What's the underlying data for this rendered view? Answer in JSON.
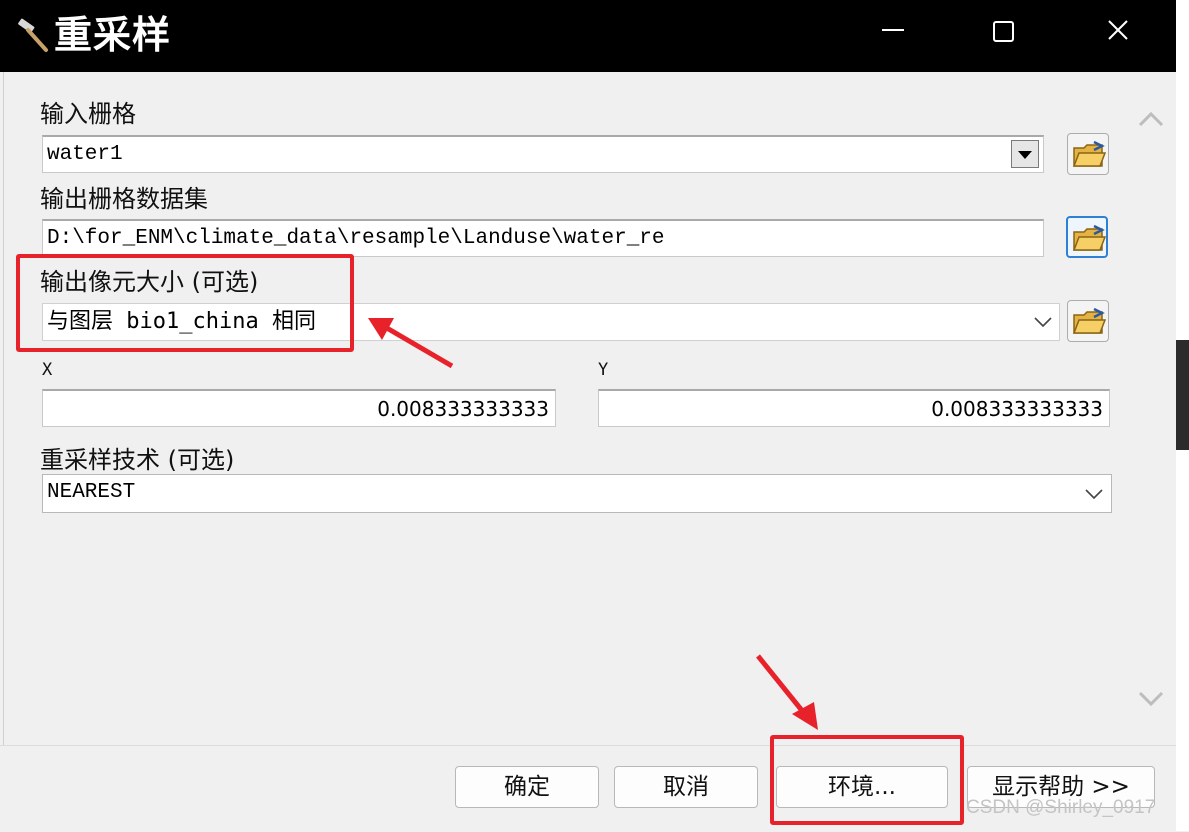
{
  "window": {
    "title": "重采样",
    "icon": "hammer-icon",
    "controls": [
      "minimize-icon",
      "maximize-icon",
      "close-icon"
    ]
  },
  "form": {
    "input_raster": {
      "label": "输入栅格",
      "value": "water1"
    },
    "output_dataset": {
      "label": "输出栅格数据集",
      "value": "D:\\for_ENM\\climate_data\\resample\\Landuse\\water_re"
    },
    "cell_size": {
      "label": "输出像元大小 (可选)",
      "value": "与图层 bio1_china 相同",
      "x_label": "X",
      "x_value": "0.008333333333",
      "y_label": "Y",
      "y_value": "0.008333333333"
    },
    "technique": {
      "label": "重采样技术 (可选)",
      "value": "NEAREST"
    }
  },
  "buttons": {
    "ok": "确定",
    "cancel": "取消",
    "environments": "环境...",
    "show_help": "显示帮助 >>"
  },
  "watermark": "CSDN @Shirley_0917",
  "colors": {
    "annotation_red": "#e8222a",
    "focus_blue": "#2f7fd6",
    "titlebar": "#000000"
  }
}
